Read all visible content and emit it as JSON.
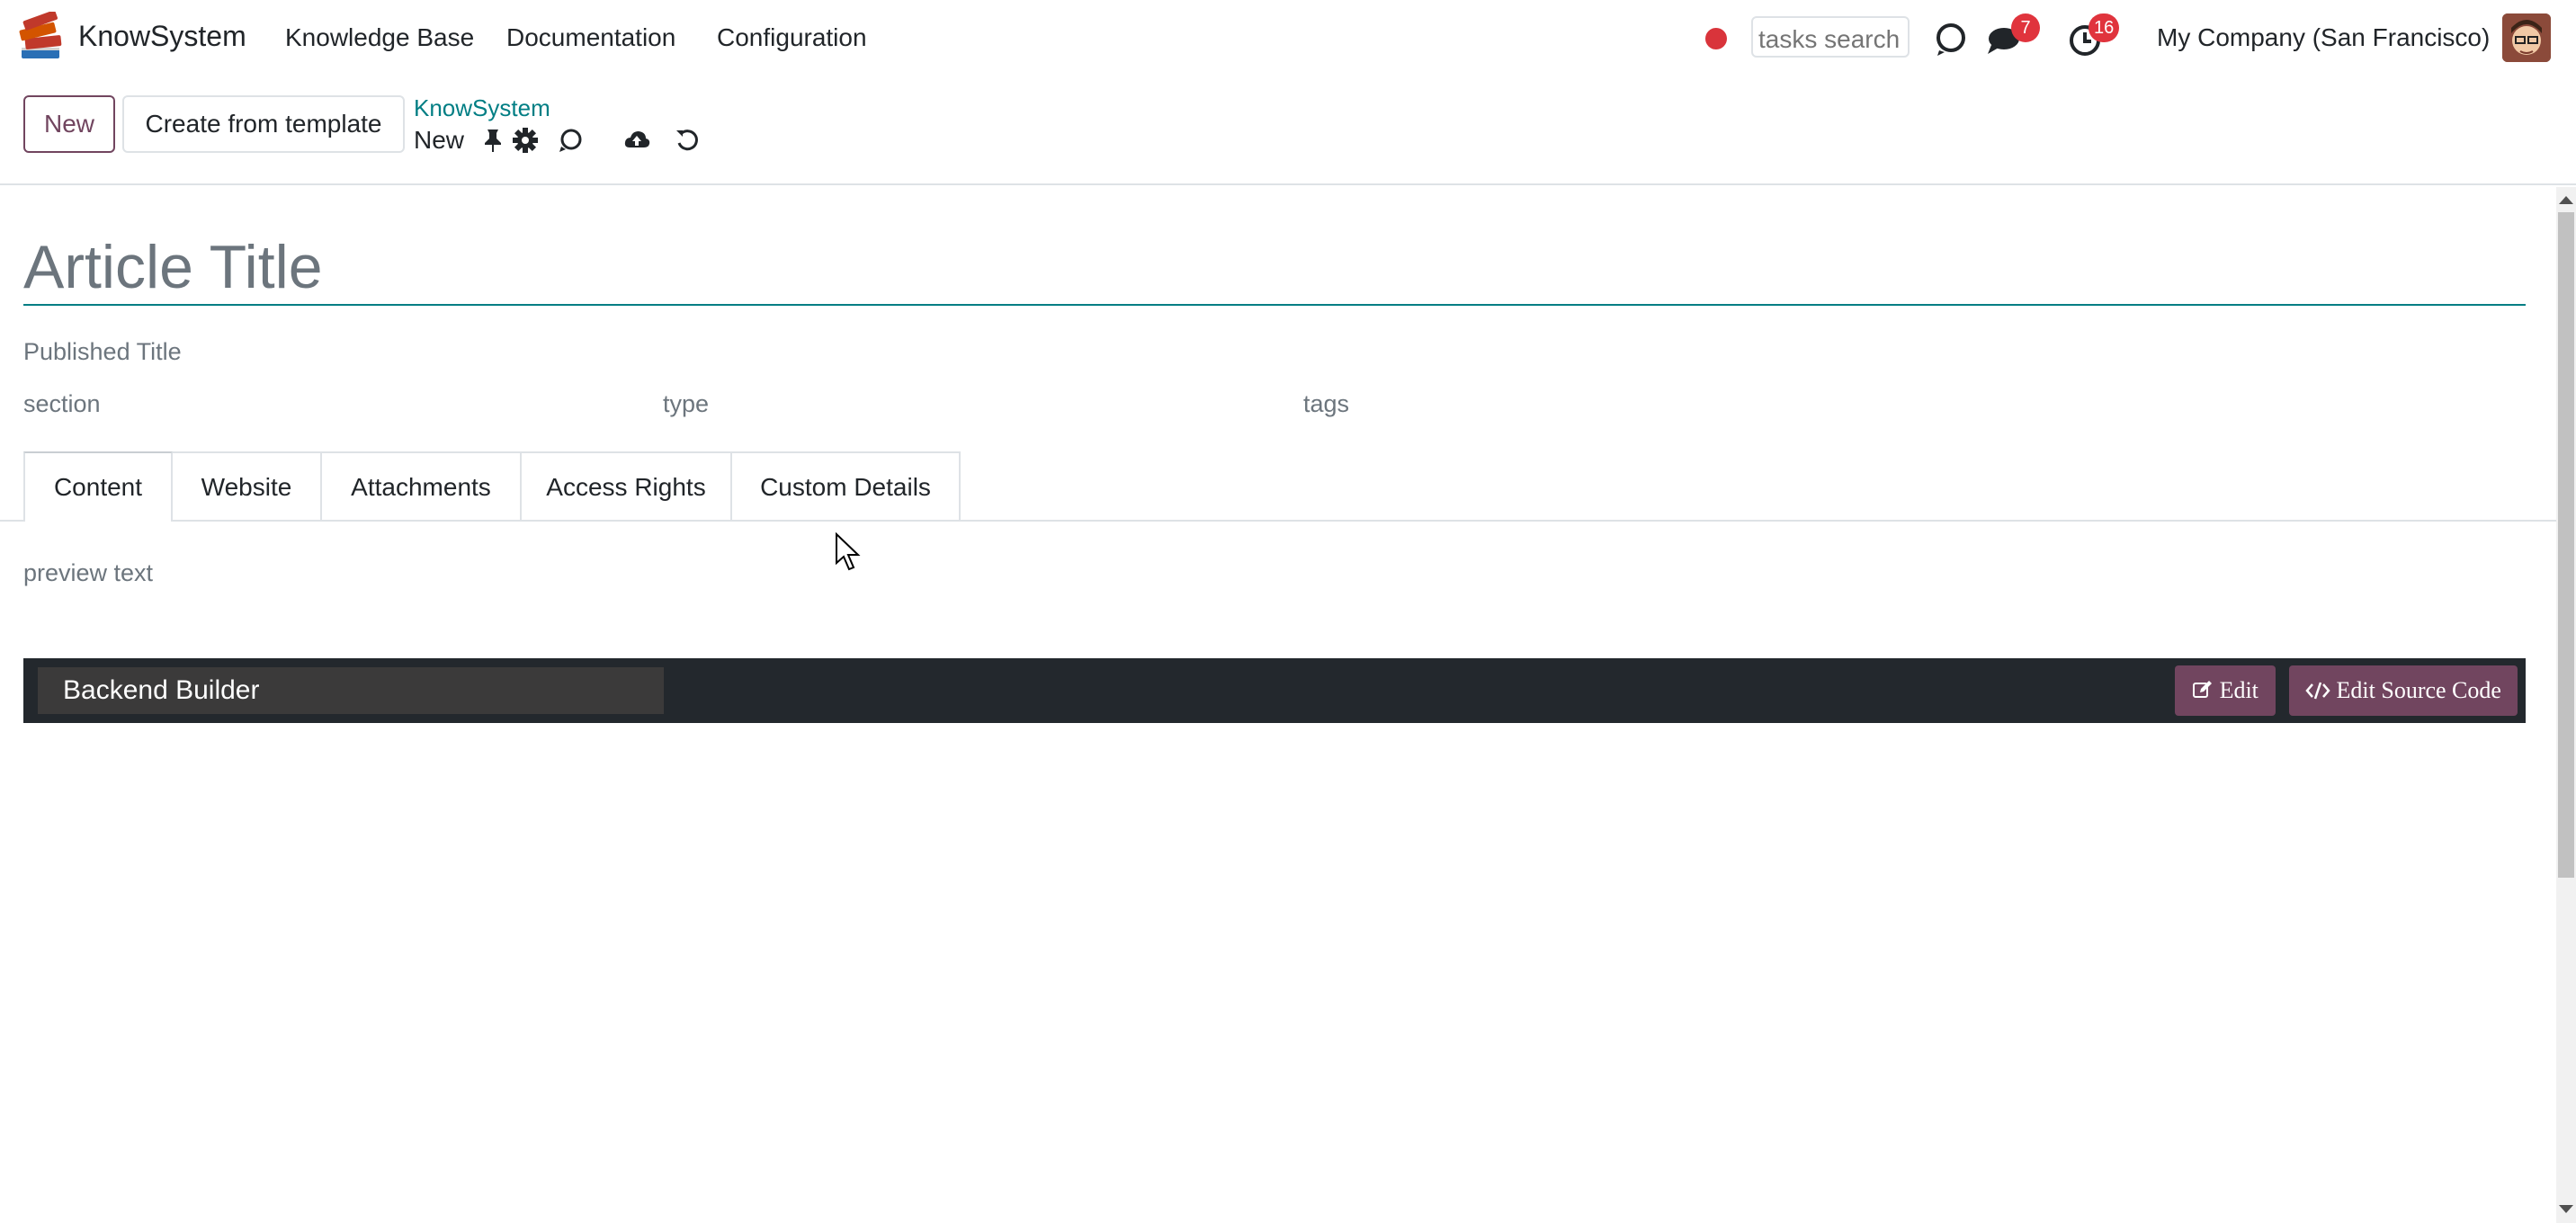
{
  "navbar": {
    "app_name": "KnowSystem",
    "menu": [
      "Knowledge Base",
      "Documentation",
      "Configuration"
    ],
    "search_placeholder": "tasks search",
    "messages_count": "7",
    "activities_count": "16",
    "company": "My Company (San Francisco)"
  },
  "control_panel": {
    "new_button": "New",
    "template_button": "Create from template",
    "breadcrumb_parent": "KnowSystem",
    "breadcrumb_current": "New"
  },
  "form": {
    "title_placeholder": "Article Title",
    "published_title_placeholder": "Published Title",
    "section_placeholder": "section",
    "type_placeholder": "type",
    "tags_placeholder": "tags",
    "tabs": [
      "Content",
      "Website",
      "Attachments",
      "Access Rights",
      "Custom Details"
    ],
    "active_tab": "Content",
    "preview_placeholder": "preview text"
  },
  "builder": {
    "name": "Backend Builder",
    "edit_button": "Edit",
    "edit_source_button": "Edit Source Code"
  },
  "colors": {
    "brand": "#71455f",
    "accent": "#017e84",
    "badge": "#e0343d",
    "recording": "#d9343b",
    "builder_bar": "#23282d"
  },
  "icons": [
    "books-logo-icon",
    "record-dot-icon",
    "discuss-icon",
    "chat-icon",
    "clock-icon",
    "avatar",
    "pin-icon",
    "gear-icon",
    "refresh-icon",
    "cloud-upload-icon",
    "undo-icon",
    "edit-icon",
    "code-icon"
  ]
}
